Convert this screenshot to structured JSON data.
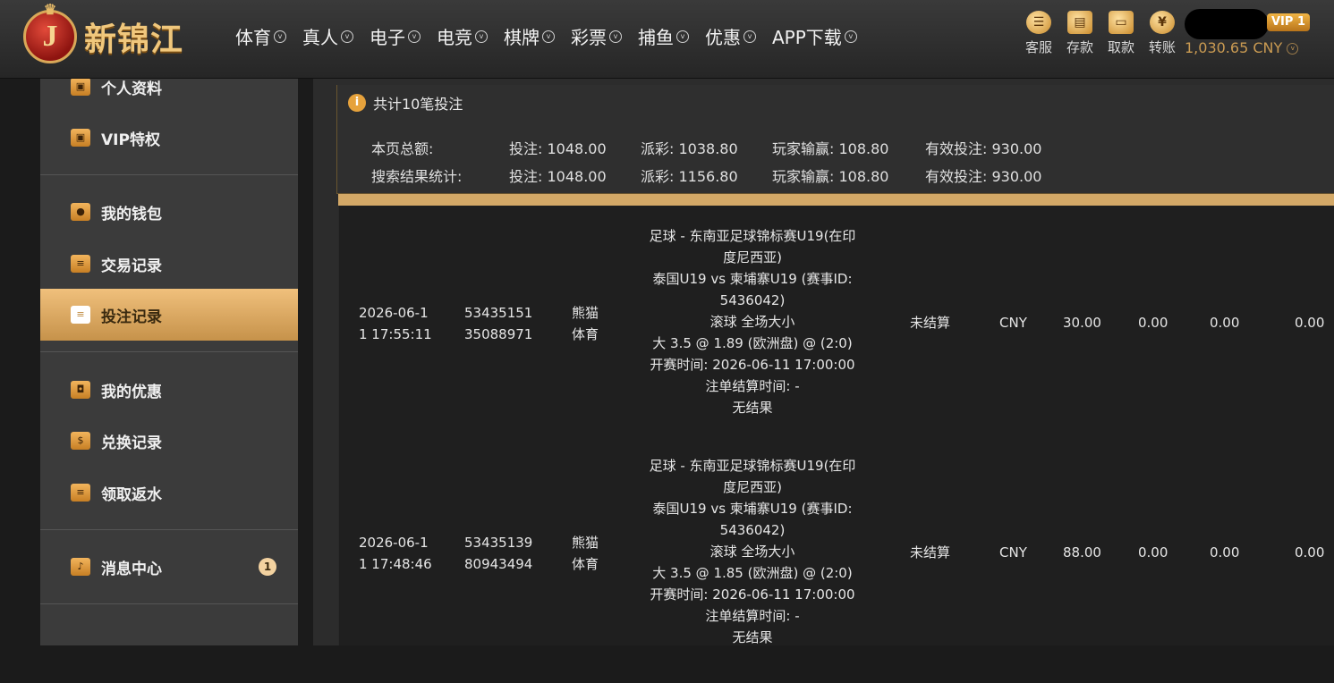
{
  "header": {
    "brand": "新锦江",
    "logo_letter": "J",
    "nav": [
      "体育",
      "真人",
      "电子",
      "电竞",
      "棋牌",
      "彩票",
      "捕鱼",
      "优惠",
      "APP下载"
    ],
    "tools": [
      {
        "label": "客服",
        "icon": "customer-service-icon"
      },
      {
        "label": "存款",
        "icon": "wallet-icon"
      },
      {
        "label": "取款",
        "icon": "withdraw-icon"
      },
      {
        "label": "转账",
        "icon": "transfer-icon"
      }
    ],
    "vip": "VIP 1",
    "balance": "1,030.65 CNY"
  },
  "sidebar": {
    "items": [
      {
        "label": "个人资料",
        "icon": "profile-icon"
      },
      {
        "label": "VIP特权",
        "icon": "vip-card-icon"
      },
      {
        "label": "我的钱包",
        "icon": "piggy-bank-icon"
      },
      {
        "label": "交易记录",
        "icon": "document-icon"
      },
      {
        "label": "投注记录",
        "icon": "bet-record-icon"
      },
      {
        "label": "我的优惠",
        "icon": "gift-bag-icon"
      },
      {
        "label": "兑换记录",
        "icon": "money-bag-icon"
      },
      {
        "label": "领取返水",
        "icon": "rebate-icon"
      },
      {
        "label": "消息中心",
        "icon": "bell-icon"
      }
    ],
    "message_count": "1"
  },
  "summary": {
    "total_text": "共计10笔投注",
    "page_label": "本页总额:",
    "search_label": "搜索结果统计:",
    "page": {
      "bet": "投注: 1048.00",
      "payout": "派彩: 1038.80",
      "win": "玩家输赢: 108.80",
      "valid": "有效投注: 930.00"
    },
    "search": {
      "bet": "投注: 1048.00",
      "payout": "派彩: 1156.80",
      "win": "玩家输赢: 108.80",
      "valid": "有效投注: 930.00"
    }
  },
  "bets": [
    {
      "time_1": "2026-06-1",
      "time_2": "1 17:55:11",
      "id_1": "53435151",
      "id_2": "35088971",
      "venue_1": "熊猫",
      "venue_2": "体育",
      "detail": [
        "足球 - 东南亚足球锦标赛U19(在印",
        "度尼西亚)",
        "泰国U19 vs 柬埔寨U19 (赛事ID:",
        "5436042)",
        "滚球 全场大小",
        "大 3.5 @ 1.89 (欧洲盘) @ (2:0)",
        "开赛时间: 2026-06-11 17:00:00",
        "注单结算时间: -",
        "无结果"
      ],
      "status": "未结算",
      "currency": "CNY",
      "amount": "30.00",
      "v1": "0.00",
      "v2": "0.00",
      "v3": "0.00"
    },
    {
      "time_1": "2026-06-1",
      "time_2": "1 17:48:46",
      "id_1": "53435139",
      "id_2": "80943494",
      "venue_1": "熊猫",
      "venue_2": "体育",
      "detail": [
        "足球 - 东南亚足球锦标赛U19(在印",
        "度尼西亚)",
        "泰国U19 vs 柬埔寨U19 (赛事ID:",
        "5436042)",
        "滚球 全场大小",
        "大 3.5 @ 1.85 (欧洲盘) @ (2:0)",
        "开赛时间: 2026-06-11 17:00:00",
        "注单结算时间: -",
        "无结果"
      ],
      "status": "未结算",
      "currency": "CNY",
      "amount": "88.00",
      "v1": "0.00",
      "v2": "0.00",
      "v3": "0.00"
    }
  ]
}
